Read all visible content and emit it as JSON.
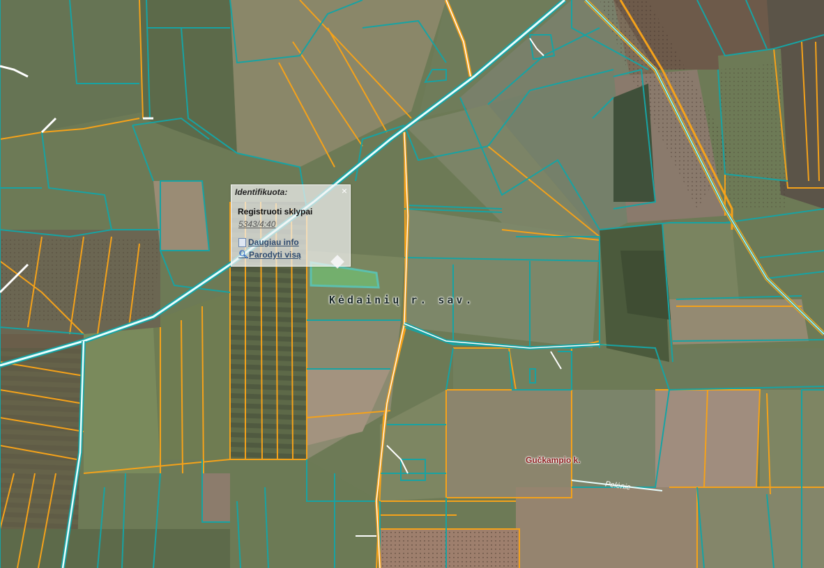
{
  "popup": {
    "title": "Identifikuota:",
    "close_symbol": "×",
    "layer_name": "Registruoti sklypai",
    "parcel_id": "5343/4:40",
    "more_info": "Daugiau info",
    "show_all": "Parodyti visą"
  },
  "labels": {
    "municipality": "Kėdainių r. sav.",
    "village": "Gučkampio k.",
    "road": "Pelėnie"
  },
  "icons": {
    "more_info": "document-icon",
    "show_all": "magnifier-icon",
    "close": "close-icon"
  },
  "colors": {
    "parcel_boundary_teal": "#17a3a3",
    "parcel_boundary_orange": "#f5a21a",
    "road_white": "#e8ffff",
    "highlight_parcel": "#44f0f0"
  }
}
